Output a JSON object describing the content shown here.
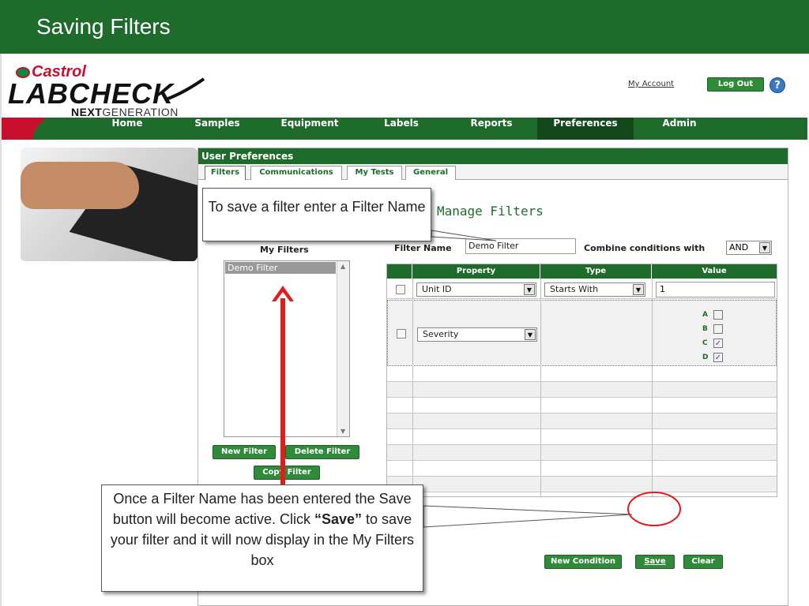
{
  "slide": {
    "title": "Saving Filters"
  },
  "header": {
    "logo_brand": "Castrol",
    "logo_product": "LABCHECK",
    "logo_tag_bold": "NEXT",
    "logo_tag": "GENERATION",
    "my_account": "My Account",
    "logout": "Log Out",
    "help": "?"
  },
  "nav": {
    "items": [
      {
        "label": "Home"
      },
      {
        "label": "Samples"
      },
      {
        "label": "Equipment"
      },
      {
        "label": "Labels"
      },
      {
        "label": "Reports"
      },
      {
        "label": "Preferences"
      },
      {
        "label": "Admin"
      }
    ],
    "active": "Preferences"
  },
  "panel": {
    "title": "User Preferences",
    "tabs": [
      {
        "label": "Filters"
      },
      {
        "label": "Communications"
      },
      {
        "label": "My Tests"
      },
      {
        "label": "General"
      }
    ],
    "manage_title": "Manage Filters",
    "my_filters_label": "My Filters",
    "my_filters_items": [
      "Demo Filter"
    ],
    "buttons": {
      "new_filter": "New Filter",
      "delete_filter": "Delete Filter",
      "copy_filter": "Copy Filter",
      "new_condition": "New Condition",
      "save": "Save",
      "clear": "Clear"
    },
    "filter_name_label": "Filter Name",
    "filter_name_value": "Demo Filter",
    "combine_label": "Combine conditions with",
    "combine_value": "AND",
    "grid": {
      "headers": [
        "Property",
        "Type",
        "Value"
      ],
      "rows": [
        {
          "property": "Unit ID",
          "type": "Starts With",
          "value": "1"
        },
        {
          "property": "Severity",
          "type": "",
          "options": [
            {
              "label": "A",
              "checked": false
            },
            {
              "label": "B",
              "checked": false
            },
            {
              "label": "C",
              "checked": true
            },
            {
              "label": "D",
              "checked": true
            }
          ]
        }
      ]
    }
  },
  "callouts": {
    "top": "To save a filter enter a Filter Name",
    "bottom_pre": "Once a Filter Name has been entered the Save button will become active.  Click ",
    "bottom_bold": "“Save”",
    "bottom_post": " to save your filter and it will now display in the My Filters box"
  },
  "colors": {
    "brand_green": "#1e6b2b",
    "brand_red": "#c8102e",
    "arrow_red": "#e31b1b"
  },
  "icons": {
    "help": "help-icon",
    "dropdown": "chevron-down-icon",
    "checkbox": "checkbox-icon"
  }
}
